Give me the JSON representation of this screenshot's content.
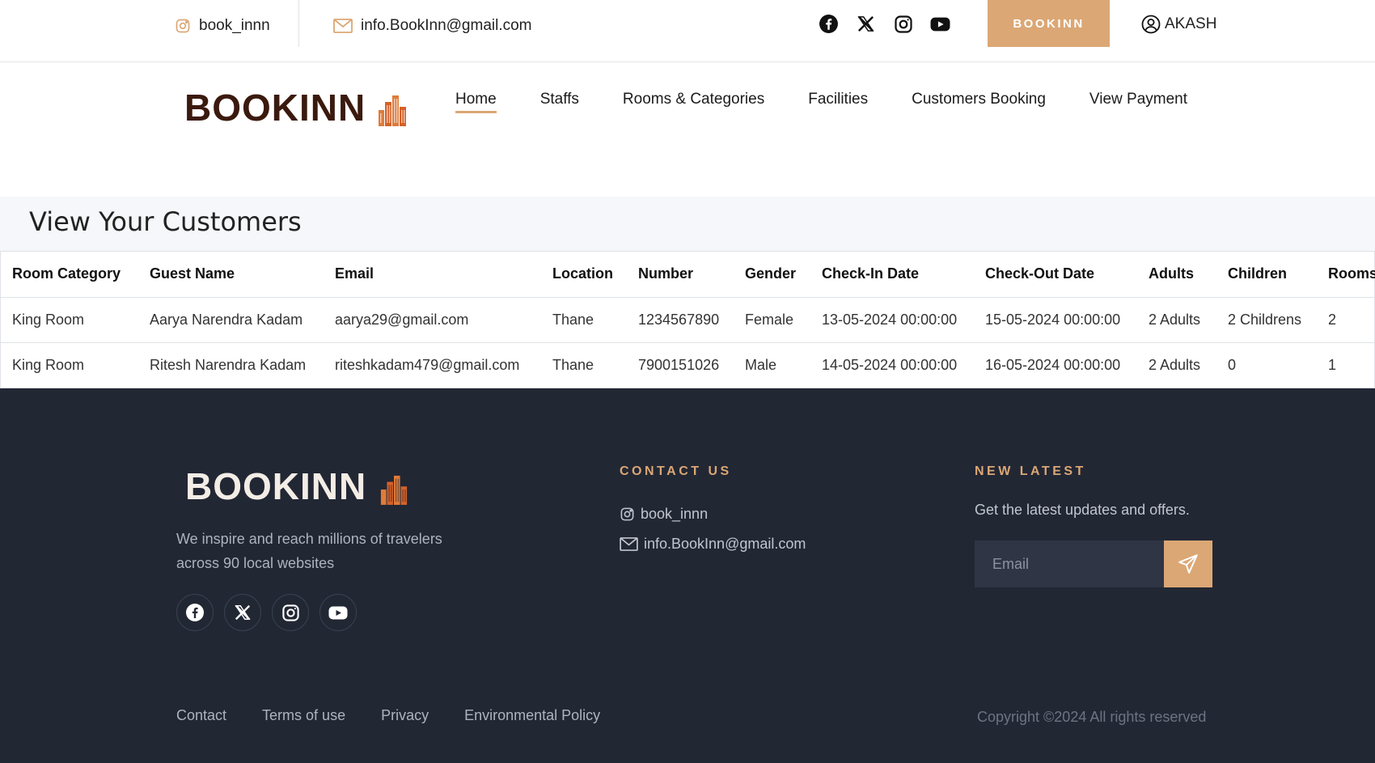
{
  "topbar": {
    "instagram_handle": "book_innn",
    "email": "info.BookInn@gmail.com",
    "social_icons": [
      "facebook-icon",
      "x-icon",
      "instagram-icon",
      "youtube-icon"
    ],
    "cta_label": "BOOKINN",
    "user_name": "AKASH"
  },
  "nav": {
    "brand": "BOOKINN",
    "links": [
      {
        "label": "Home",
        "active": true
      },
      {
        "label": "Staffs",
        "active": false
      },
      {
        "label": "Rooms & Categories",
        "active": false
      },
      {
        "label": "Facilities",
        "active": false
      },
      {
        "label": "Customers Booking",
        "active": false
      },
      {
        "label": "View Payment",
        "active": false
      }
    ]
  },
  "main": {
    "title": "View Your Customers",
    "table": {
      "columns": [
        "Room Category",
        "Guest Name",
        "Email",
        "Location",
        "Number",
        "Gender",
        "Check-In Date",
        "Check-Out Date",
        "Adults",
        "Children",
        "Rooms"
      ],
      "rows": [
        [
          "King Room",
          "Aarya Narendra Kadam",
          "aarya29@gmail.com",
          "Thane",
          "1234567890",
          "Female",
          "13-05-2024 00:00:00",
          "15-05-2024 00:00:00",
          "2 Adults",
          "2 Childrens",
          "2"
        ],
        [
          "King Room",
          "Ritesh Narendra Kadam",
          "riteshkadam479@gmail.com",
          "Thane",
          "7900151026",
          "Male",
          "14-05-2024 00:00:00",
          "16-05-2024 00:00:00",
          "2 Adults",
          "0",
          "1"
        ]
      ]
    }
  },
  "footer": {
    "brand": "BOOKINN",
    "description": "We inspire and reach millions of travelers across 90 local websites",
    "contact_heading": "CONTACT US",
    "contact_instagram": "book_innn",
    "contact_email": "info.BookInn@gmail.com",
    "newsletter_heading": "NEW LATEST",
    "newsletter_text": "Get the latest updates and offers.",
    "email_placeholder": "Email",
    "links": [
      "Contact",
      "Terms of use",
      "Privacy",
      "Environmental Policy"
    ],
    "copyright": "Copyright ©2024 All rights reserved"
  },
  "colors": {
    "accent": "#dba775",
    "brand_dark": "#3b1a0e",
    "footer_bg": "#222734"
  }
}
